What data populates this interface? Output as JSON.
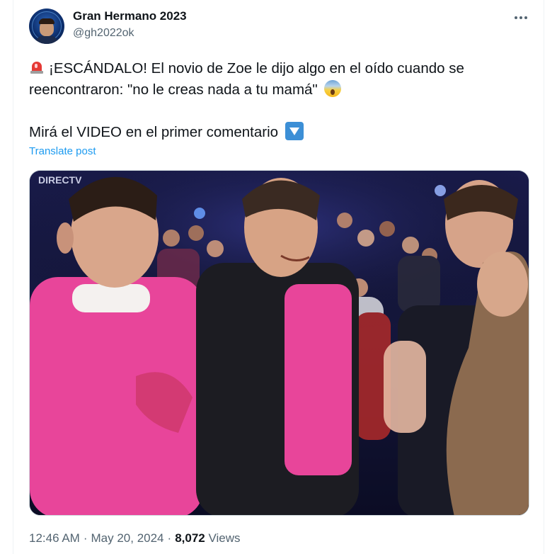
{
  "author": {
    "display_name": "Gran Hermano 2023",
    "handle": "@gh2022ok",
    "avatar_icon": "profile-avatar"
  },
  "post": {
    "line1": "¡ESCÁNDALO! El novio de Zoe le dijo algo en el oído cuando se",
    "line2": "reencontraron: \"no le creas nada a tu mamá\"",
    "line3": "Mirá el VIDEO en el primer comentario",
    "emoji_start": "rotating-light-icon",
    "emoji_mid": "face-screaming-icon",
    "emoji_end": "down-button-icon",
    "translate_label": "Translate post"
  },
  "media": {
    "watermark": "DIRECTV",
    "shirt_color": "#e8459a"
  },
  "meta": {
    "time": "12:46 AM",
    "date": "May 20, 2024",
    "views_count": "8,072",
    "views_label": "Views",
    "separator": "·"
  },
  "colors": {
    "link": "#1d9bf0",
    "secondary_text": "#536471",
    "primary_text": "#0f1419"
  }
}
